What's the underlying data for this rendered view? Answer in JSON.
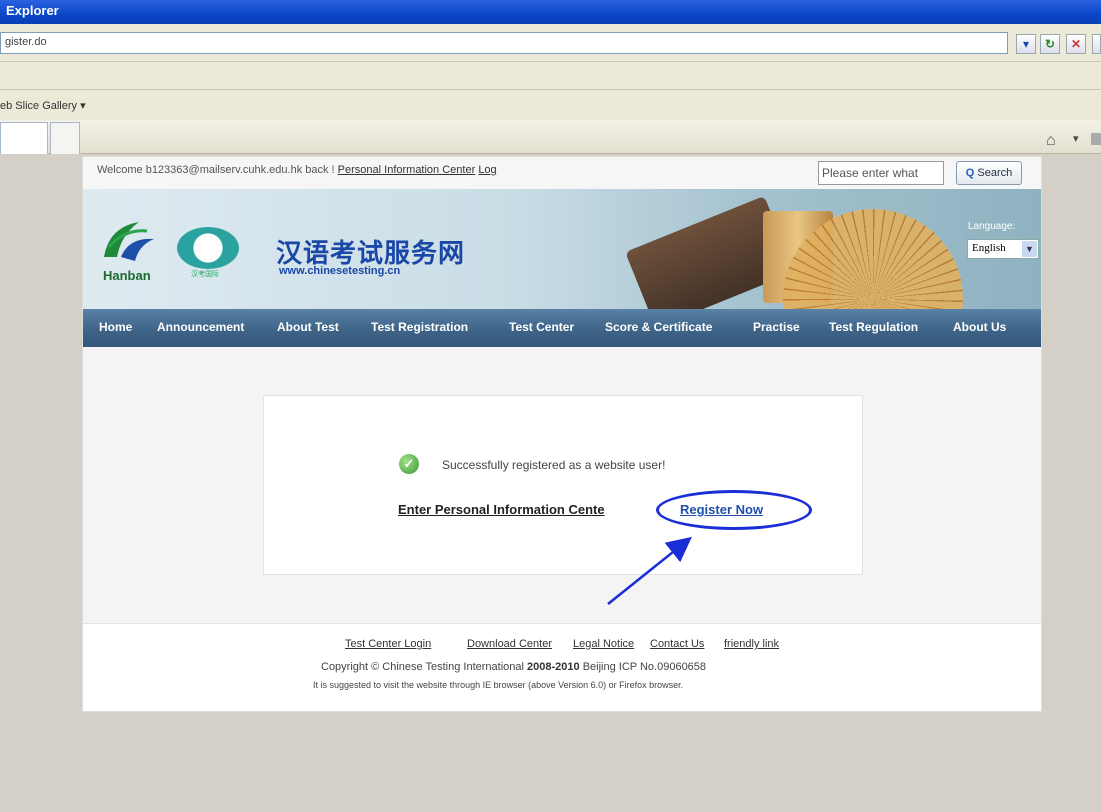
{
  "browser": {
    "window_title": "Explorer",
    "address": "gister.do",
    "favorites_item": "eb Slice Gallery ▾"
  },
  "header": {
    "welcome_prefix": "Welcome  b123363@mailserv.cuhk.edu.hk  back !",
    "personal_center_link": "Personal Information Center",
    "logout_link": "Log",
    "search_placeholder": "Please enter what",
    "search_button": "Search"
  },
  "banner": {
    "logo_text": "Hanban",
    "seal_caption": "汉考国际",
    "site_name": "汉语考试服务网",
    "site_url": "www.chinesetesting.cn",
    "language_label": "Language:",
    "language_value": "English"
  },
  "nav": {
    "items": [
      "Home",
      "Announcement",
      "About Test",
      "Test Registration",
      "Test Center",
      "Score & Certificate",
      "Practise",
      "Test Regulation",
      "About Us"
    ]
  },
  "main": {
    "success_message": "Successfully registered as a website user!",
    "enter_center_link": "Enter Personal Information Cente",
    "register_now_link": "Register Now"
  },
  "footer": {
    "links": [
      "Test Center Login",
      "Download Center",
      "Legal Notice",
      "Contact Us",
      "friendly link"
    ],
    "copyright_prefix": "Copyright © Chinese Testing International",
    "copyright_years": "2008-2010",
    "copyright_suffix": "Beijing ICP No.09060658",
    "suggestion": "It is suggested to visit the website through IE browser (above Version 6.0) or Firefox browser."
  },
  "colors": {
    "annotation": "#1a2ed6",
    "nav_bg": "#3e6488",
    "brand_blue": "#1b47a6",
    "link_blue": "#1f4fa8"
  }
}
